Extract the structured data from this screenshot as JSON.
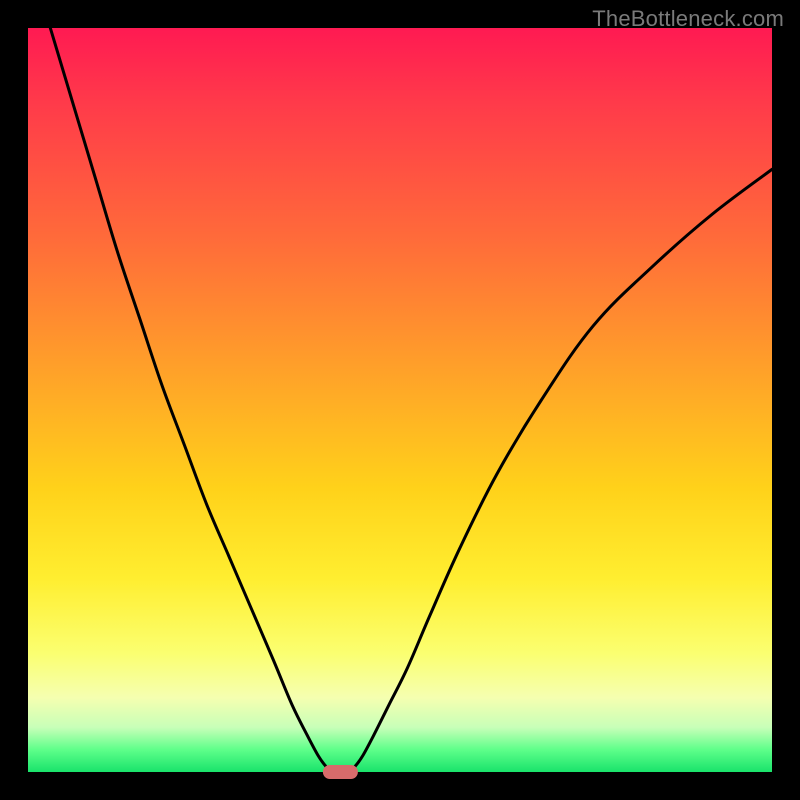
{
  "watermark": {
    "text": "TheBottleneck.com"
  },
  "colors": {
    "frame": "#000000",
    "gradient_top": "#ff1a52",
    "gradient_mid": "#ffd21a",
    "gradient_bottom": "#19e36b",
    "curve": "#000000",
    "marker": "#d76b6b"
  },
  "chart_data": {
    "type": "line",
    "title": "",
    "xlabel": "",
    "ylabel": "",
    "xlim": [
      0,
      100
    ],
    "ylim": [
      0,
      100
    ],
    "grid": false,
    "legend": false,
    "annotations": [],
    "series": [
      {
        "name": "left-branch",
        "x": [
          3,
          6,
          9,
          12,
          15,
          18,
          21,
          24,
          27,
          30,
          33,
          35.5,
          37.5,
          39,
          40,
          40.8
        ],
        "values": [
          100,
          90,
          80,
          70,
          61,
          52,
          44,
          36,
          29,
          22,
          15,
          9,
          5,
          2.2,
          0.8,
          0
        ]
      },
      {
        "name": "right-branch",
        "x": [
          43.2,
          44,
          45,
          46.5,
          48.5,
          51,
          54,
          58,
          63,
          69,
          76,
          84,
          92,
          100
        ],
        "values": [
          0,
          0.8,
          2.2,
          5,
          9,
          14,
          21,
          30,
          40,
          50,
          60,
          68,
          75,
          81
        ]
      }
    ],
    "marker": {
      "x_center": 42,
      "x_halfwidth": 2.3,
      "y": 0
    }
  }
}
